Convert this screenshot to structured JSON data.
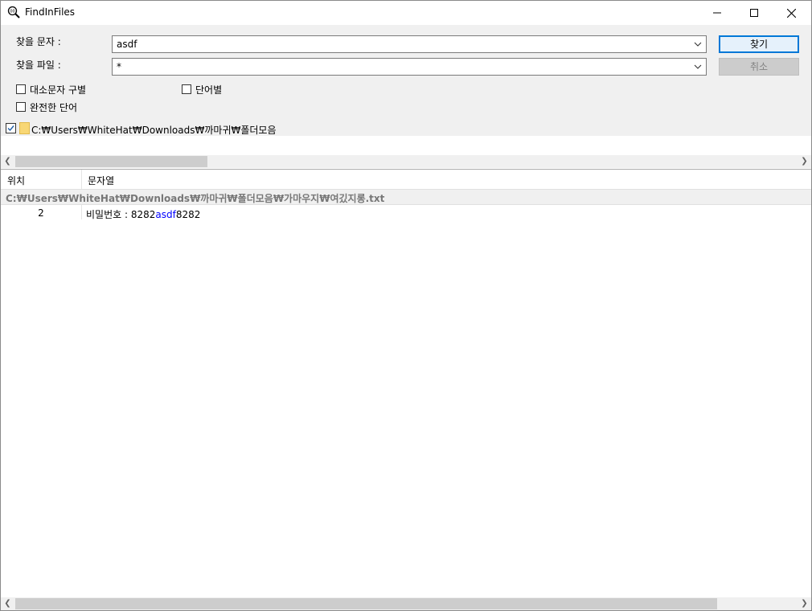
{
  "window": {
    "title": "FindInFiles"
  },
  "search": {
    "find_text_label": "찾을 문자 :",
    "find_text_value": "asdf",
    "find_file_label": "찾을 파일 :",
    "find_file_value": "*",
    "find_button": "찾기",
    "cancel_button": "취소"
  },
  "options": {
    "match_case": "대소문자 구별",
    "by_word": "단어별",
    "whole_word": "완전한 단어"
  },
  "tree": {
    "folder_path": "C:₩Users₩WhiteHat₩Downloads₩까마귀₩폴더모음",
    "checked": true
  },
  "results": {
    "columns": [
      "위치",
      "문자열"
    ],
    "file_path": "C:₩Users₩WhiteHat₩Downloads₩까마귀₩폴더모음₩가마우지₩여깄지롱.txt",
    "rows": [
      {
        "position": "2",
        "prefix": "비밀번호 : 8282",
        "match": "asdf",
        "suffix": "8282"
      }
    ]
  },
  "colors": {
    "accent": "#0078d7",
    "match_highlight": "#0000ff"
  }
}
